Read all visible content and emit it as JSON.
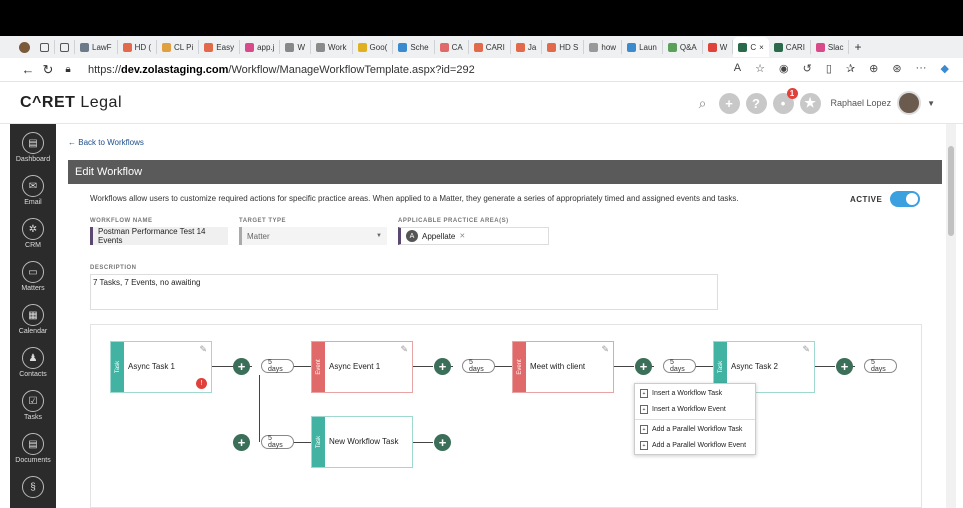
{
  "browser": {
    "tabs": [
      {
        "label": "LawF",
        "color": "#6c7a89"
      },
      {
        "label": "HD (",
        "color": "#e26a4a"
      },
      {
        "label": "CL Pi",
        "color": "#e0a040"
      },
      {
        "label": "Easy",
        "color": "#e26a4a"
      },
      {
        "label": "app.j",
        "color": "#d94a8a"
      },
      {
        "label": "W",
        "color": "#888888"
      },
      {
        "label": "Work",
        "color": "#8a8a8a"
      },
      {
        "label": "Goo(",
        "color": "#e0b020"
      },
      {
        "label": "Sche",
        "color": "#3a8ad0"
      },
      {
        "label": "CA",
        "color": "#e06a6a"
      },
      {
        "label": "CARI",
        "color": "#e26a4a"
      },
      {
        "label": "Ja",
        "color": "#e26a4a"
      },
      {
        "label": "HD S",
        "color": "#e26a4a"
      },
      {
        "label": "how",
        "color": "#999999"
      },
      {
        "label": "Laun",
        "color": "#3a8ad0"
      },
      {
        "label": "Q&A",
        "color": "#5aa05a"
      },
      {
        "label": "W",
        "color": "#e0413a"
      },
      {
        "label": "C",
        "color": "#2a6a4a"
      },
      {
        "label": "CARI",
        "color": "#2a6a4a"
      },
      {
        "label": "Slac",
        "color": "#d94a8a"
      }
    ],
    "url_prefix": "https://",
    "url_domain": "dev.zolastaging.com",
    "url_path": "/Workflow/ManageWorkflowTemplate.aspx?id=292"
  },
  "app": {
    "logo_a": "C^RET",
    "logo_b": " Legal",
    "user_name": "Raphael Lopez",
    "notification_count": "1"
  },
  "sidebar": [
    {
      "label": "Dashboard",
      "icon": "dashboard-icon"
    },
    {
      "label": "Email",
      "icon": "email-icon"
    },
    {
      "label": "CRM",
      "icon": "crm-icon"
    },
    {
      "label": "Matters",
      "icon": "matters-icon"
    },
    {
      "label": "Calendar",
      "icon": "calendar-icon"
    },
    {
      "label": "Contacts",
      "icon": "contacts-icon"
    },
    {
      "label": "Tasks",
      "icon": "tasks-icon"
    },
    {
      "label": "Documents",
      "icon": "documents-icon"
    },
    {
      "label": "",
      "icon": "billing-icon"
    }
  ],
  "page": {
    "back_link": "Back to Workflows",
    "title": "Edit Workflow",
    "description": "Workflows allow users to customize required actions for specific practice areas. When applied to a Matter, they generate a series of appropriately timed and assigned events and tasks.",
    "active_label": "ACTIVE",
    "active": true
  },
  "form": {
    "workflow_name_label": "WORKFLOW NAME",
    "workflow_name": "Postman Performance Test  14 Events",
    "target_type_label": "TARGET TYPE",
    "target_type": "Matter",
    "practice_area_label": "APPLICABLE PRACTICE AREA(S)",
    "practice_area_chip": "Appellate",
    "practice_area_initial": "A",
    "description_label": "DESCRIPTION",
    "description_value": "7 Tasks, 7 Events, no awaiting"
  },
  "workflow": {
    "nodes": [
      {
        "type": "Task",
        "title": "Async Task 1"
      },
      {
        "type": "Event",
        "title": "Async Event 1"
      },
      {
        "type": "Event",
        "title": "Meet with client"
      },
      {
        "type": "Task",
        "title": "Async Task 2"
      },
      {
        "type": "Task",
        "title": "New Workflow Task"
      }
    ],
    "delays": [
      "5 days",
      "5 days",
      "5 days",
      "5 days",
      "5 days"
    ]
  },
  "context_menu": {
    "items": [
      "Insert a Workflow Task",
      "Insert a Workflow Event",
      "Add a Parallel Workflow Task",
      "Add a Parallel Workflow Event"
    ]
  }
}
